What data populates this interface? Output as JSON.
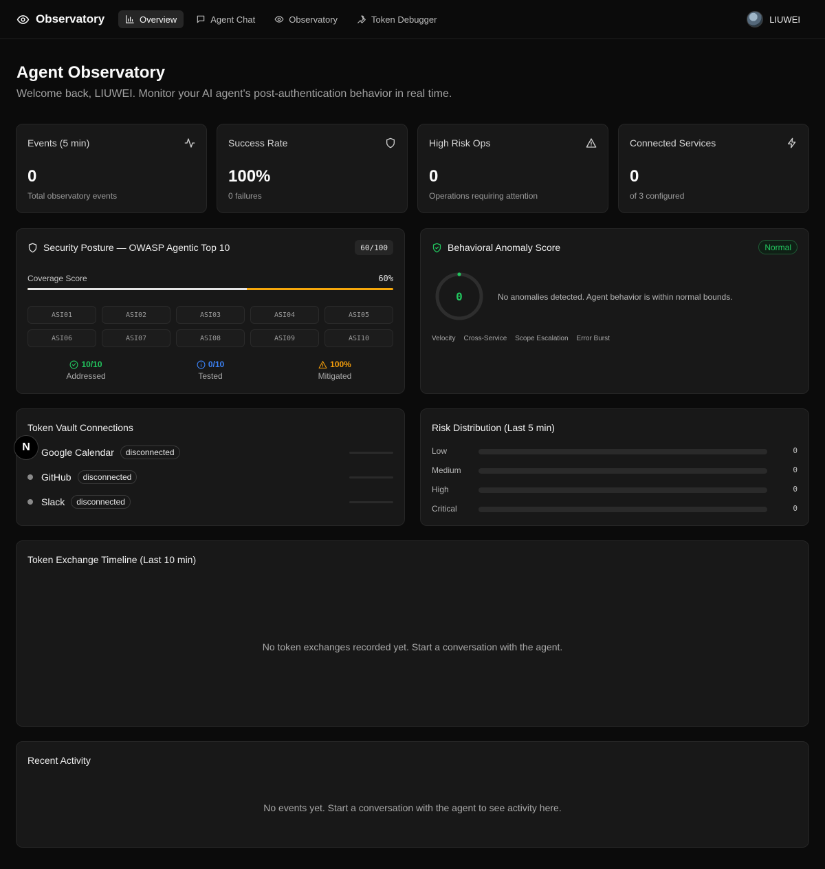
{
  "nav": {
    "brand": "Observatory",
    "tabs": [
      {
        "label": "Overview",
        "icon": "bar-chart-icon",
        "active": true
      },
      {
        "label": "Agent Chat",
        "icon": "chat-icon",
        "active": false
      },
      {
        "label": "Observatory",
        "icon": "eye-icon",
        "active": false
      },
      {
        "label": "Token Debugger",
        "icon": "wrench-icon",
        "active": false
      }
    ],
    "user": "LIUWEI"
  },
  "header": {
    "title": "Agent Observatory",
    "subtitle": "Welcome back, LIUWEI. Monitor your AI agent's post-authentication behavior in real time."
  },
  "stats": [
    {
      "title": "Events (5 min)",
      "value": "0",
      "desc": "Total observatory events",
      "icon": "activity-icon"
    },
    {
      "title": "Success Rate",
      "value": "100%",
      "desc": "0 failures",
      "icon": "shield-icon"
    },
    {
      "title": "High Risk Ops",
      "value": "0",
      "desc": "Operations requiring attention",
      "icon": "warning-icon"
    },
    {
      "title": "Connected Services",
      "value": "0",
      "desc": "of 3 configured",
      "icon": "lightning-icon"
    }
  ],
  "posture": {
    "title": "Security Posture — OWASP Agentic Top 10",
    "score": "60/100",
    "coverage_label": "Coverage Score",
    "coverage_pct": "60%",
    "coverage_value": 60,
    "items": [
      "ASI01",
      "ASI02",
      "ASI03",
      "ASI04",
      "ASI05",
      "ASI06",
      "ASI07",
      "ASI08",
      "ASI09",
      "ASI10"
    ],
    "addressed": {
      "value": "10/10",
      "label": "Addressed",
      "color": "#22c55e"
    },
    "tested": {
      "value": "0/10",
      "label": "Tested",
      "color": "#3b82f6"
    },
    "mitigated": {
      "value": "100%",
      "label": "Mitigated",
      "color": "#f59e0b"
    }
  },
  "anomaly": {
    "title": "Behavioral Anomaly Score",
    "badge": "Normal",
    "score": "0",
    "message": "No anomalies detected. Agent behavior is within normal bounds.",
    "factors": [
      "Velocity",
      "Cross-Service",
      "Scope Escalation",
      "Error Burst"
    ]
  },
  "vault": {
    "title": "Token Vault Connections",
    "connections": [
      {
        "name": "Google Calendar",
        "status": "disconnected"
      },
      {
        "name": "GitHub",
        "status": "disconnected"
      },
      {
        "name": "Slack",
        "status": "disconnected"
      }
    ]
  },
  "risk": {
    "title": "Risk Distribution (Last 5 min)",
    "levels": [
      {
        "label": "Low",
        "count": "0",
        "value": 0
      },
      {
        "label": "Medium",
        "count": "0",
        "value": 0
      },
      {
        "label": "High",
        "count": "0",
        "value": 0
      },
      {
        "label": "Critical",
        "count": "0",
        "value": 0
      }
    ]
  },
  "timeline": {
    "title": "Token Exchange Timeline (Last 10 min)",
    "empty": "No token exchanges recorded yet. Start a conversation with the agent."
  },
  "activity": {
    "title": "Recent Activity",
    "empty": "No events yet. Start a conversation with the agent to see activity here."
  },
  "dev_badge": "N"
}
